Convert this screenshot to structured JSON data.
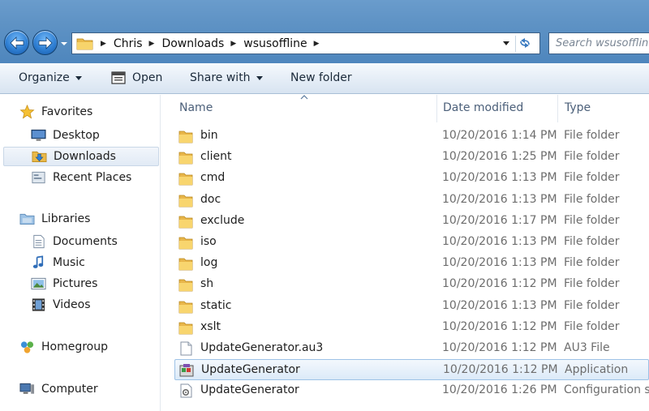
{
  "address": {
    "breadcrumbs": [
      "Chris",
      "Downloads",
      "wsusoffline"
    ]
  },
  "search": {
    "placeholder": "Search wsusofflin"
  },
  "toolbar": {
    "organize": "Organize",
    "open": "Open",
    "share_with": "Share with",
    "new_folder": "New folder"
  },
  "nav": {
    "favorites": "Favorites",
    "desktop": "Desktop",
    "downloads": "Downloads",
    "recent_places": "Recent Places",
    "libraries": "Libraries",
    "documents": "Documents",
    "music": "Music",
    "pictures": "Pictures",
    "videos": "Videos",
    "homegroup": "Homegroup",
    "computer": "Computer"
  },
  "columns": {
    "name": "Name",
    "date_modified": "Date modified",
    "type": "Type"
  },
  "files": [
    {
      "name": "bin",
      "date": "10/20/2016 1:14 PM",
      "type": "File folder",
      "icon": "folder-icon"
    },
    {
      "name": "client",
      "date": "10/20/2016 1:25 PM",
      "type": "File folder",
      "icon": "folder-icon"
    },
    {
      "name": "cmd",
      "date": "10/20/2016 1:13 PM",
      "type": "File folder",
      "icon": "folder-icon"
    },
    {
      "name": "doc",
      "date": "10/20/2016 1:13 PM",
      "type": "File folder",
      "icon": "folder-icon"
    },
    {
      "name": "exclude",
      "date": "10/20/2016 1:17 PM",
      "type": "File folder",
      "icon": "folder-icon"
    },
    {
      "name": "iso",
      "date": "10/20/2016 1:13 PM",
      "type": "File folder",
      "icon": "folder-icon"
    },
    {
      "name": "log",
      "date": "10/20/2016 1:13 PM",
      "type": "File folder",
      "icon": "folder-icon"
    },
    {
      "name": "sh",
      "date": "10/20/2016 1:12 PM",
      "type": "File folder",
      "icon": "folder-icon"
    },
    {
      "name": "static",
      "date": "10/20/2016 1:13 PM",
      "type": "File folder",
      "icon": "folder-icon"
    },
    {
      "name": "xslt",
      "date": "10/20/2016 1:12 PM",
      "type": "File folder",
      "icon": "folder-icon"
    },
    {
      "name": "UpdateGenerator.au3",
      "date": "10/20/2016 1:12 PM",
      "type": "AU3 File",
      "icon": "document-icon"
    },
    {
      "name": "UpdateGenerator",
      "date": "10/20/2016 1:12 PM",
      "type": "Application",
      "icon": "application-icon",
      "selected": true
    },
    {
      "name": "UpdateGenerator",
      "date": "10/20/2016 1:26 PM",
      "type": "Configuration se",
      "icon": "config-file-icon"
    }
  ],
  "colors": {
    "titlebar": "#5f93c5",
    "selection": "#dceaf8",
    "folder": "#f2c94c"
  }
}
